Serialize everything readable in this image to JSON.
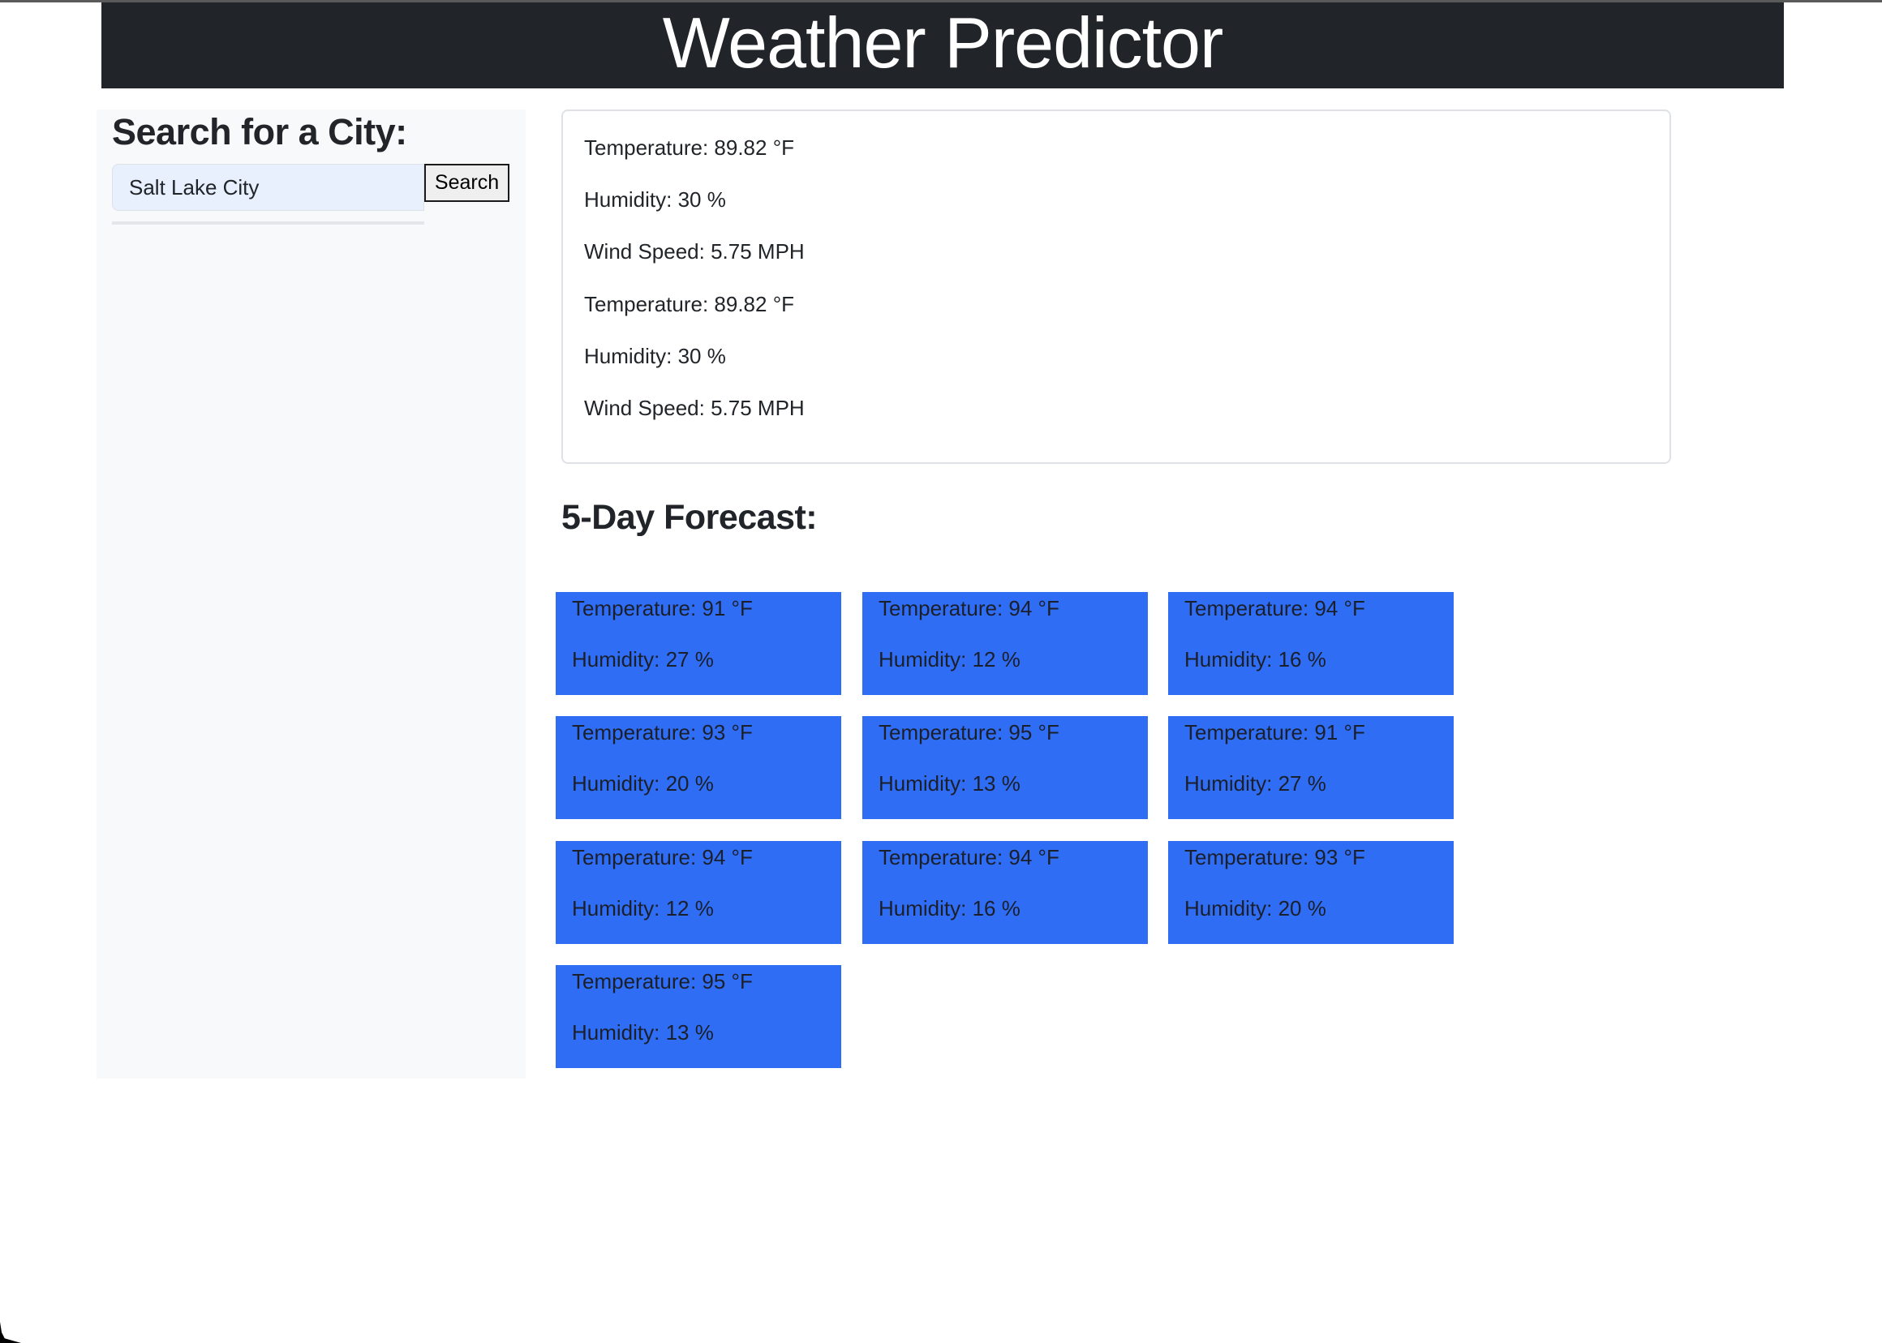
{
  "header": {
    "title": "Weather Predictor"
  },
  "sidebar": {
    "heading": "Search for a City:",
    "search": {
      "value": "Salt Lake City",
      "button_label": "Search"
    }
  },
  "current": {
    "lines": [
      "Temperature: 89.82 °F",
      "Humidity: 30 %",
      "Wind Speed: 5.75 MPH",
      "Temperature: 89.82 °F",
      "Humidity: 30 %",
      "Wind Speed: 5.75 MPH"
    ]
  },
  "forecast": {
    "heading": "5-Day Forecast:",
    "cards": [
      {
        "temp": "Temperature: 91 °F",
        "humidity": "Humidity: 27 %"
      },
      {
        "temp": "Temperature: 94 °F",
        "humidity": "Humidity: 12 %"
      },
      {
        "temp": "Temperature: 94 °F",
        "humidity": "Humidity: 16 %"
      },
      {
        "temp": "Temperature: 93 °F",
        "humidity": "Humidity: 20 %"
      },
      {
        "temp": "Temperature: 95 °F",
        "humidity": "Humidity: 13 %"
      },
      {
        "temp": "Temperature: 91 °F",
        "humidity": "Humidity: 27 %"
      },
      {
        "temp": "Temperature: 94 °F",
        "humidity": "Humidity: 12 %"
      },
      {
        "temp": "Temperature: 94 °F",
        "humidity": "Humidity: 16 %"
      },
      {
        "temp": "Temperature: 93 °F",
        "humidity": "Humidity: 20 %"
      },
      {
        "temp": "Temperature: 95 °F",
        "humidity": "Humidity: 13 %"
      }
    ]
  },
  "colors": {
    "header_bg": "#212529",
    "sidebar_bg": "#f8f9fa",
    "forecast_card_bg": "#2f6df4"
  }
}
